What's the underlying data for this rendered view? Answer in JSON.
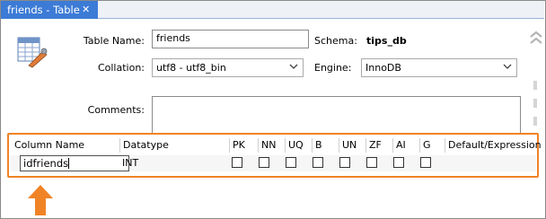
{
  "tab": {
    "title": "friends - Table",
    "close_glyph": "✕"
  },
  "form": {
    "table_name_label": "Table Name:",
    "table_name_value": "friends",
    "schema_label": "Schema:",
    "schema_value": "tips_db",
    "collation_label": "Collation:",
    "collation_value": "utf8 - utf8_bin",
    "engine_label": "Engine:",
    "engine_value": "InnoDB",
    "comments_label": "Comments:",
    "comments_value": ""
  },
  "columns_grid": {
    "headers": [
      "Column Name",
      "Datatype",
      "PK",
      "NN",
      "UQ",
      "B",
      "UN",
      "ZF",
      "AI",
      "G",
      "Default/Expression"
    ],
    "row": {
      "column_name": "idfriends",
      "datatype": "INT",
      "flags": {
        "PK": false,
        "NN": false,
        "UQ": false,
        "B": false,
        "UN": false,
        "ZF": false,
        "AI": false,
        "G": false
      },
      "default": ""
    }
  },
  "colors": {
    "tab_active": "#3c7bd6",
    "highlight": "#f08326"
  },
  "icons": [
    "table-edit-icon",
    "collapse-chevron-icon",
    "dropdown-arrow-icon",
    "highlight-arrow-icon"
  ]
}
